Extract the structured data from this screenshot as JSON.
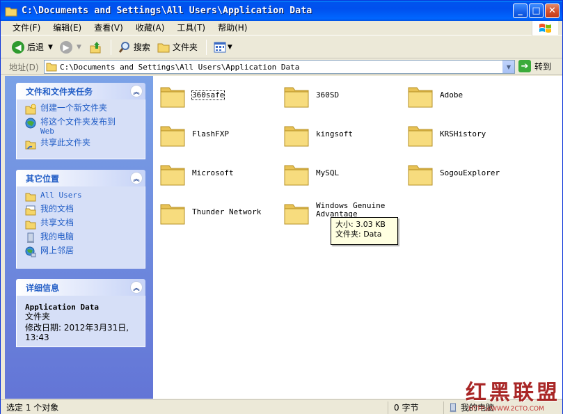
{
  "window": {
    "title": "C:\\Documents and Settings\\All Users\\Application Data",
    "minimize": "_",
    "maximize": "□",
    "close": "✕"
  },
  "menu": [
    {
      "label": "文件(F)"
    },
    {
      "label": "编辑(E)"
    },
    {
      "label": "查看(V)"
    },
    {
      "label": "收藏(A)"
    },
    {
      "label": "工具(T)"
    },
    {
      "label": "帮助(H)"
    }
  ],
  "toolbar": {
    "back_label": "后退",
    "search_label": "搜索",
    "folders_label": "文件夹"
  },
  "address": {
    "label": "地址(D)",
    "value": "C:\\Documents and Settings\\All Users\\Application Data",
    "go_label": "转到"
  },
  "panels": {
    "tasks": {
      "title": "文件和文件夹任务",
      "items": [
        {
          "label": "创建一个新文件夹",
          "icon": "new-folder-icon"
        },
        {
          "label": "将这个文件夹发布到",
          "label2": "Web",
          "icon": "publish-web-icon"
        },
        {
          "label": "共享此文件夹",
          "icon": "share-folder-icon"
        }
      ]
    },
    "places": {
      "title": "其它位置",
      "items": [
        {
          "label": "All Users",
          "icon": "folder-icon"
        },
        {
          "label": "我的文档",
          "icon": "my-documents-icon"
        },
        {
          "label": "共享文档",
          "icon": "shared-documents-icon"
        },
        {
          "label": "我的电脑",
          "icon": "my-computer-icon"
        },
        {
          "label": "网上邻居",
          "icon": "network-places-icon"
        }
      ]
    },
    "details": {
      "title": "详细信息",
      "name": "Application Data",
      "type": "文件夹",
      "modified_line1": "修改日期: 2012年3月31日,",
      "modified_line2": "13:43"
    }
  },
  "folders": [
    {
      "name": "360safe"
    },
    {
      "name": "360SD"
    },
    {
      "name": "Adobe"
    },
    {
      "name": "FlashFXP"
    },
    {
      "name": "kingsoft"
    },
    {
      "name": "KRSHistory"
    },
    {
      "name": "Microsoft"
    },
    {
      "name": "MySQL"
    },
    {
      "name": "SogouExplorer"
    },
    {
      "name": "Thunder Network"
    },
    {
      "name": "Windows Genuine",
      "name2": "Advantage"
    }
  ],
  "tooltip": {
    "size": "大小: 3.03 KB",
    "folder": "文件夹: Data"
  },
  "status": {
    "selection": "选定 1 个对象",
    "size": "0 字节",
    "location": "我的电脑"
  },
  "watermark": {
    "text": "红黑联盟",
    "url": "HTTP://WWW.2CTO.COM"
  }
}
